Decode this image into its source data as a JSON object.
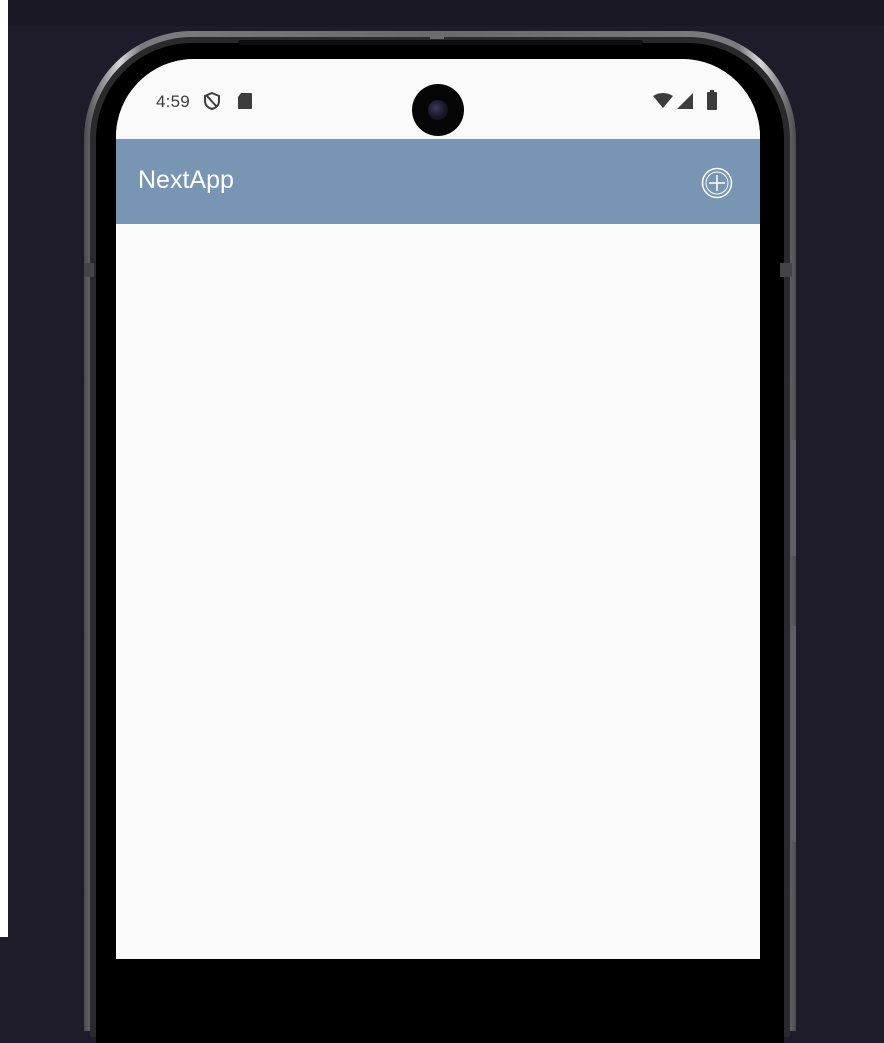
{
  "status_bar": {
    "time": "4:59",
    "left_icons": [
      "shield-icon",
      "sd-card-icon"
    ],
    "right_icons": [
      "wifi-icon",
      "signal-icon",
      "battery-icon"
    ]
  },
  "app_bar": {
    "title": "NextApp",
    "action_icon": "add-circle-icon",
    "background_color": "#7896b3"
  },
  "colors": {
    "screen_background": "#fafafa",
    "device_background": "#1e1c2b"
  }
}
